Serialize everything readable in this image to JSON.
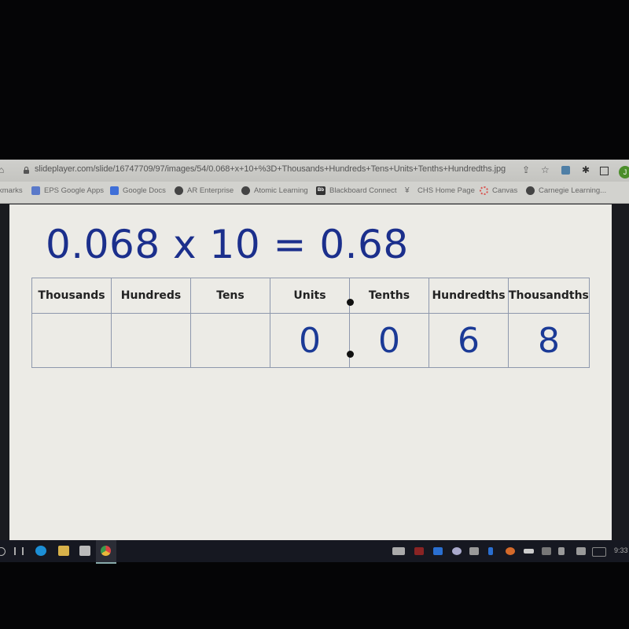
{
  "browser": {
    "url": "slideplayer.com/slide/16747709/97/images/54/0.068+x+10+%3D+Thousands+Hundreds+Tens+Units+Tenths+Hundredths.jpg",
    "toolbar_icons": [
      "share-icon",
      "star-icon",
      "extension-icon",
      "puzzle-icon",
      "sidebar-icon"
    ],
    "avatar_initial": "J",
    "bookmarks": [
      {
        "label": "kmarks",
        "icon": "none"
      },
      {
        "label": "EPS Google Apps",
        "icon": "apps-icon"
      },
      {
        "label": "Google Docs",
        "icon": "docs-icon"
      },
      {
        "label": "AR Enterprise",
        "icon": "globe-icon"
      },
      {
        "label": "Atomic Learning",
        "icon": "globe-icon"
      },
      {
        "label": "Blackboard Connect",
        "icon": "blackboard-icon"
      },
      {
        "label": "CHS Home Page",
        "icon": "chs-icon"
      },
      {
        "label": "Canvas",
        "icon": "canvas-icon"
      },
      {
        "label": "Carnegie Learning...",
        "icon": "globe-icon"
      }
    ],
    "blackboard_abbr": "Bb"
  },
  "slide": {
    "equation": "0.068 x 10 = 0.68",
    "headers": [
      "Thousands",
      "Hundreds",
      "Tens",
      "Units",
      "Tenths",
      "Hundredths",
      "Thousandths"
    ],
    "values": [
      "",
      "",
      "",
      "0",
      "0",
      "6",
      "8"
    ]
  },
  "taskbar": {
    "apps": [
      "search-icon",
      "task-view-icon",
      "edge-icon",
      "file-explorer-icon",
      "store-icon",
      "chrome-icon"
    ],
    "tray": [
      "keyboard-icon",
      "acrobat-icon",
      "zoom-icon",
      "app-icon",
      "app2-icon",
      "bluetooth-icon",
      "app3-icon",
      "battery-icon",
      "wifi-icon",
      "volume-icon",
      "pen-icon",
      "keyboard2-icon"
    ],
    "clock": "9:33"
  }
}
